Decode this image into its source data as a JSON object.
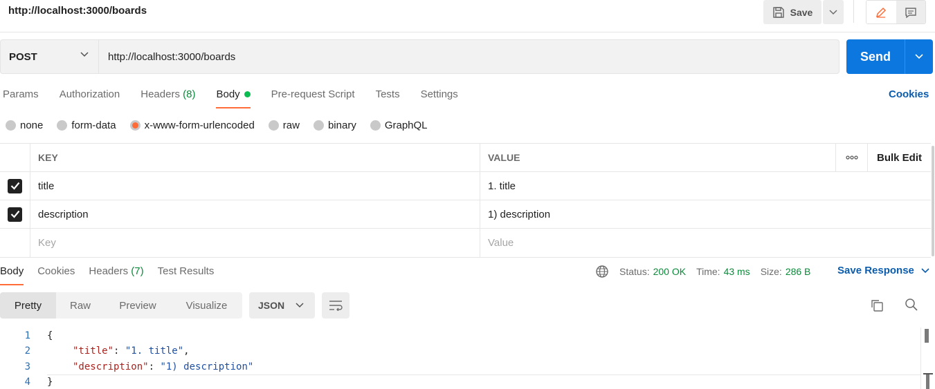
{
  "header": {
    "title": "http://localhost:3000/boards",
    "save_label": "Save"
  },
  "request": {
    "method": "POST",
    "url": "http://localhost:3000/boards",
    "send_label": "Send"
  },
  "request_tabs": [
    {
      "label": "Params"
    },
    {
      "label": "Authorization"
    },
    {
      "label": "Headers",
      "count": "(8)"
    },
    {
      "label": "Body"
    },
    {
      "label": "Pre-request Script"
    },
    {
      "label": "Tests"
    },
    {
      "label": "Settings"
    }
  ],
  "cookies_label": "Cookies",
  "body_types": [
    "none",
    "form-data",
    "x-www-form-urlencoded",
    "raw",
    "binary",
    "GraphQL"
  ],
  "selected_body_type": "x-www-form-urlencoded",
  "kv_table": {
    "headers": {
      "key": "KEY",
      "value": "VALUE",
      "more": "ooo",
      "bulk_edit": "Bulk Edit"
    },
    "rows": [
      {
        "checked": true,
        "key": "title",
        "value": "1. title"
      },
      {
        "checked": true,
        "key": "description",
        "value": "1) description"
      }
    ],
    "placeholder": {
      "key": "Key",
      "value": "Value"
    }
  },
  "response_tabs": [
    {
      "label": "Body"
    },
    {
      "label": "Cookies"
    },
    {
      "label": "Headers",
      "count": "(7)"
    },
    {
      "label": "Test Results"
    }
  ],
  "response_status": {
    "status_label": "Status:",
    "status_value": "200 OK",
    "time_label": "Time:",
    "time_value": "43 ms",
    "size_label": "Size:",
    "size_value": "286 B",
    "save_response_label": "Save Response"
  },
  "format_tabs": [
    "Pretty",
    "Raw",
    "Preview",
    "Visualize"
  ],
  "format_select": "JSON",
  "code": {
    "line_numbers": [
      "1",
      "2",
      "3",
      "4"
    ],
    "open_brace": "{",
    "close_brace": "}",
    "title_key": "\"title\"",
    "title_value": "\"1. title\"",
    "desc_key": "\"description\"",
    "desc_value": "\"1) description\""
  },
  "colors": {
    "accent_orange": "#ff6c37",
    "send_blue": "#0c77de",
    "link_blue": "#0b5cad",
    "status_green": "#0b8a3a"
  }
}
